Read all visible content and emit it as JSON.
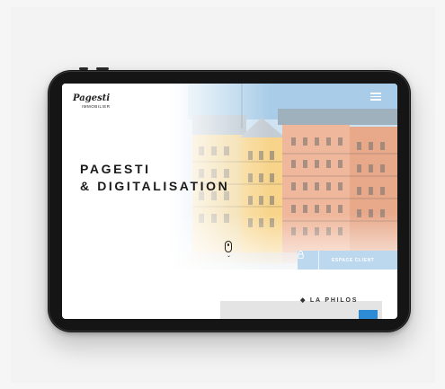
{
  "site": {
    "logo_script": "Pagesti",
    "logo_sub": "IMMOBILIER",
    "headline_line1": "PAGESTI",
    "headline_line2": "& DIGITALISATION",
    "client_button": "ESPACE CLIENT",
    "lower_text": "◆ LA PHILOS",
    "menu_icon": "hamburger-menu-icon",
    "client_icon": "lock-icon",
    "scroll_icon": "mouse-scroll-icon"
  },
  "colors": {
    "device": "#151515",
    "screen_bg": "#ffffff",
    "client_bar": "#bcd8ef",
    "accent": "#2e8bd6",
    "headline": "#1a1a1a"
  }
}
